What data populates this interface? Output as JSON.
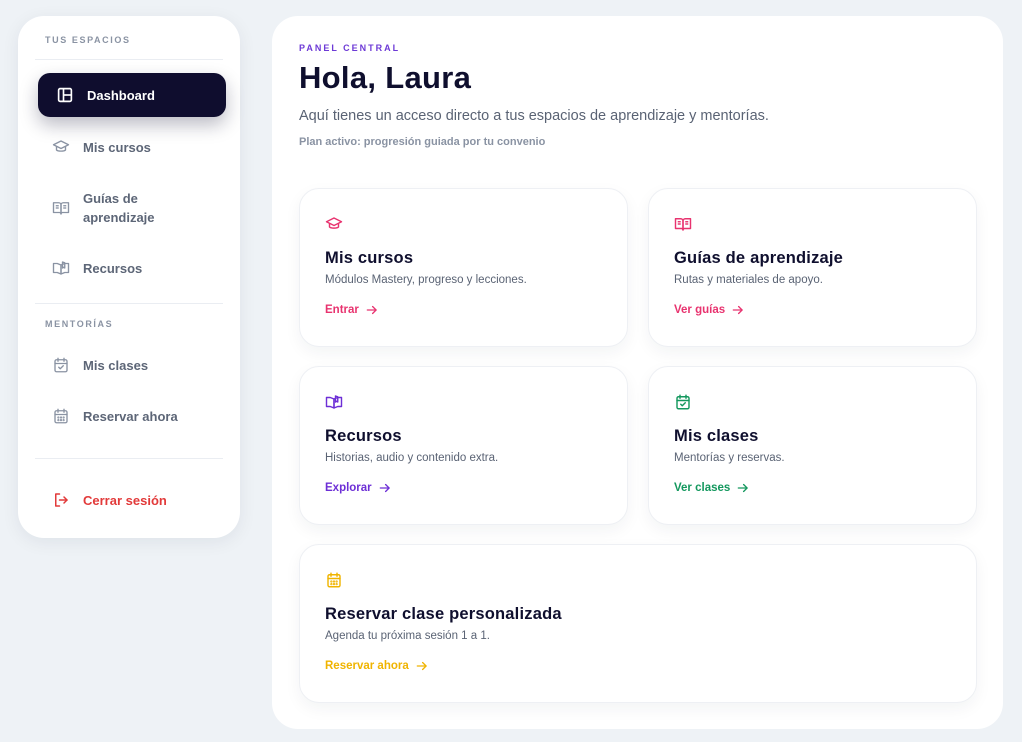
{
  "sidebar": {
    "section_spaces": "TUS ESPACIOS",
    "section_mentoring": "MENTORÍAS",
    "items": [
      {
        "label": "Dashboard",
        "icon": "layout-icon"
      },
      {
        "label": "Mis cursos",
        "icon": "graduation-cap-icon"
      },
      {
        "label": "Guías de aprendizaje",
        "icon": "book-open-icon"
      },
      {
        "label": "Recursos",
        "icon": "book-pages-icon"
      },
      {
        "label": "Mis clases",
        "icon": "calendar-check-icon"
      },
      {
        "label": "Reservar ahora",
        "icon": "calendar-grid-icon"
      }
    ],
    "guias_line1": "Guías de",
    "guias_line2": "aprendizaje",
    "logout_label": "Cerrar sesión"
  },
  "header": {
    "eyebrow": "PANEL CENTRAL",
    "title": "Hola, Laura",
    "subtitle": "Aquí tienes un acceso directo a tus espacios de aprendizaje y mentorías.",
    "plan": "Plan activo: progresión guiada por tu convenio"
  },
  "cards": [
    {
      "title": "Mis cursos",
      "desc": "Módulos Mastery, progreso y lecciones.",
      "link": "Entrar",
      "color": "#e8336f",
      "icon": "graduation-cap-icon"
    },
    {
      "title": "Guías de aprendizaje",
      "desc": "Rutas y materiales de apoyo.",
      "link": "Ver guías",
      "color": "#e8336f",
      "icon": "book-open-icon"
    },
    {
      "title": "Recursos",
      "desc": "Historias, audio y contenido extra.",
      "link": "Explorar",
      "color": "#6d2fd6",
      "icon": "book-pages-icon"
    },
    {
      "title": "Mis clases",
      "desc": "Mentorías y reservas.",
      "link": "Ver clases",
      "color": "#14985e",
      "icon": "calendar-check-icon"
    },
    {
      "title": "Reservar clase personalizada",
      "desc": "Agenda tu próxima sesión 1 a 1.",
      "link": "Reservar ahora",
      "color": "#f0b400",
      "icon": "calendar-grid-icon"
    }
  ],
  "colors": {
    "accent_dark": "#0f0d2e",
    "eyebrow": "#6d3ad6",
    "logout": "#e23a3a"
  }
}
